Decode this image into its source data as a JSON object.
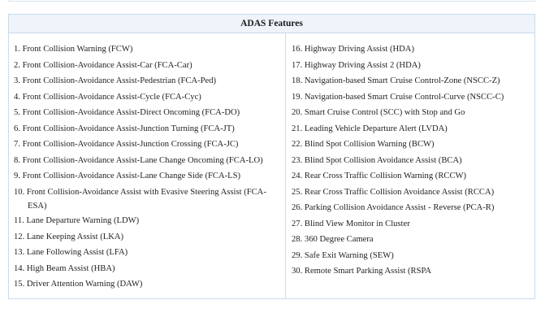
{
  "header": {
    "title": "ADAS Features"
  },
  "left_items": [
    {
      "num": "1.",
      "text": "Front Collision Warning (FCW)"
    },
    {
      "num": "2.",
      "text": "Front Collision-Avoidance Assist-Car (FCA-Car)"
    },
    {
      "num": "3.",
      "text": "Front Collision-Avoidance Assist-Pedestrian (FCA-Ped)"
    },
    {
      "num": "4.",
      "text": "Front Collision-Avoidance Assist-Cycle (FCA-Cyc)"
    },
    {
      "num": "5.",
      "text": "Front Collision-Avoidance Assist-Direct Oncoming (FCA-DO)"
    },
    {
      "num": "6.",
      "text": "Front Collision-Avoidance Assist-Junction Turning (FCA-JT)"
    },
    {
      "num": "7.",
      "text": "Front Collision-Avoidance Assist-Junction Crossing (FCA-JC)"
    },
    {
      "num": "8.",
      "text": "Front Collision-Avoidance Assist-Lane Change Oncoming (FCA-LO)"
    },
    {
      "num": "9.",
      "text": "Front Collision-Avoidance Assist-Lane Change Side (FCA-LS)"
    },
    {
      "num": "10.",
      "text": "Front Collision-Avoidance Assist with Evasive Steering Assist (FCA-",
      "cont": "ESA)"
    },
    {
      "num": "11.",
      "text": "Lane Departure Warning (LDW)"
    },
    {
      "num": "12.",
      "text": "Lane Keeping Assist (LKA)"
    },
    {
      "num": "13.",
      "text": "Lane Following Assist (LFA)"
    },
    {
      "num": "14.",
      "text": "High Beam Assist (HBA)"
    },
    {
      "num": "15.",
      "text": "Driver Attention Warning (DAW)"
    }
  ],
  "right_items": [
    {
      "num": "16.",
      "text": "Highway Driving Assist (HDA)"
    },
    {
      "num": "17.",
      "text": "Highway Driving Assist 2 (HDA)"
    },
    {
      "num": "18.",
      "text": "Navigation-based Smart Cruise Control-Zone (NSCC-Z)"
    },
    {
      "num": "19.",
      "text": "Navigation-based Smart Cruise Control-Curve (NSCC-C)"
    },
    {
      "num": "20.",
      "text": "Smart Cruise Control (SCC) with Stop and Go"
    },
    {
      "num": "21.",
      "text": "Leading Vehicle Departure Alert (LVDA)"
    },
    {
      "num": "22.",
      "text": "Blind Spot Collision Warning (BCW)"
    },
    {
      "num": "23.",
      "text": "Blind Spot Collision Avoidance Assist (BCA)"
    },
    {
      "num": "24.",
      "text": "Rear Cross Traffic Collision Warning (RCCW)"
    },
    {
      "num": "25.",
      "text": "Rear Cross Traffic Collision Avoidance Assist (RCCA)"
    },
    {
      "num": "26.",
      "text": "Parking Collision Avoidance Assist - Reverse (PCA-R)"
    },
    {
      "num": "27.",
      "text": "Blind View Monitor in Cluster"
    },
    {
      "num": "28.",
      "text": "360 Degree Camera"
    },
    {
      "num": "29.",
      "text": "Safe Exit Warning (SEW)"
    },
    {
      "num": "30.",
      "text": "Remote Smart Parking Assist (RSPA"
    }
  ]
}
